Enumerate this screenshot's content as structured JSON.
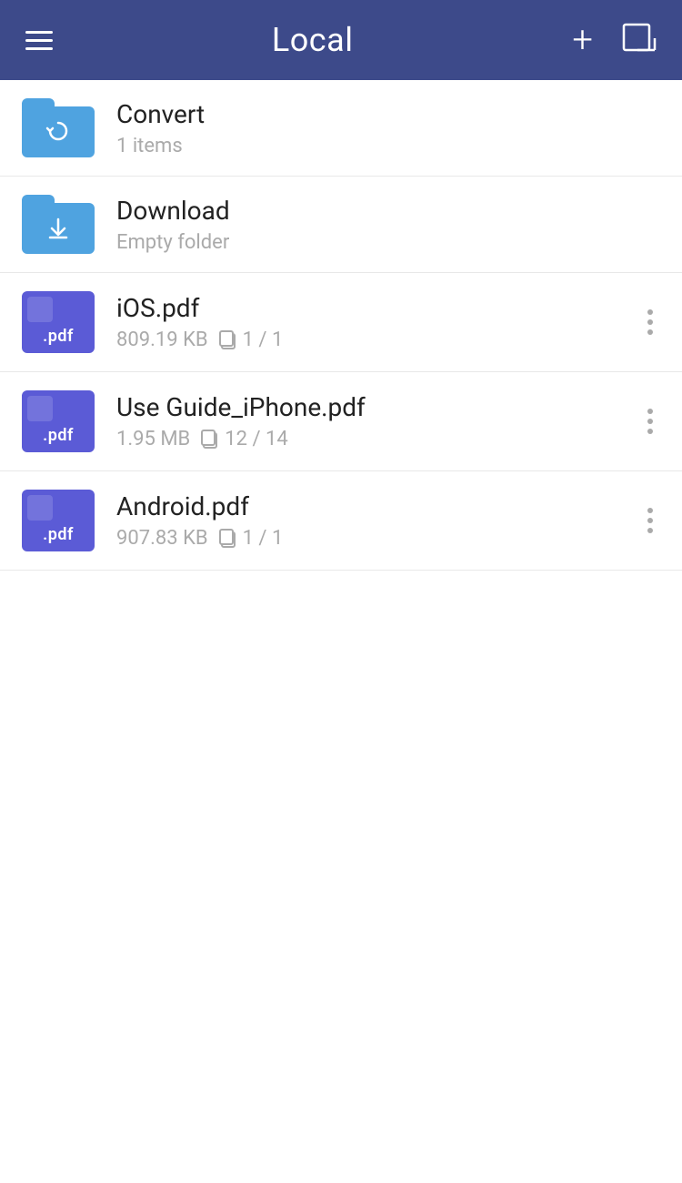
{
  "header": {
    "title": "Local",
    "menu_icon": "hamburger",
    "add_icon": "+",
    "edit_icon": "edit"
  },
  "files": [
    {
      "id": "convert",
      "type": "folder",
      "name": "Convert",
      "meta": "1 items",
      "badge_type": "refresh",
      "has_more": false
    },
    {
      "id": "download",
      "type": "folder",
      "name": "Download",
      "meta": "Empty folder",
      "badge_type": "download",
      "has_more": false
    },
    {
      "id": "ios-pdf",
      "type": "pdf",
      "name": "iOS.pdf",
      "size": "809.19 KB",
      "pages": "1 / 1",
      "has_more": true
    },
    {
      "id": "use-guide-iphone",
      "type": "pdf",
      "name": "Use Guide_iPhone.pdf",
      "size": "1.95 MB",
      "pages": "12 / 14",
      "has_more": true
    },
    {
      "id": "android-pdf",
      "type": "pdf",
      "name": "Android.pdf",
      "size": "907.83 KB",
      "pages": "1 / 1",
      "has_more": true
    }
  ],
  "labels": {
    "pdf": ".pdf"
  }
}
